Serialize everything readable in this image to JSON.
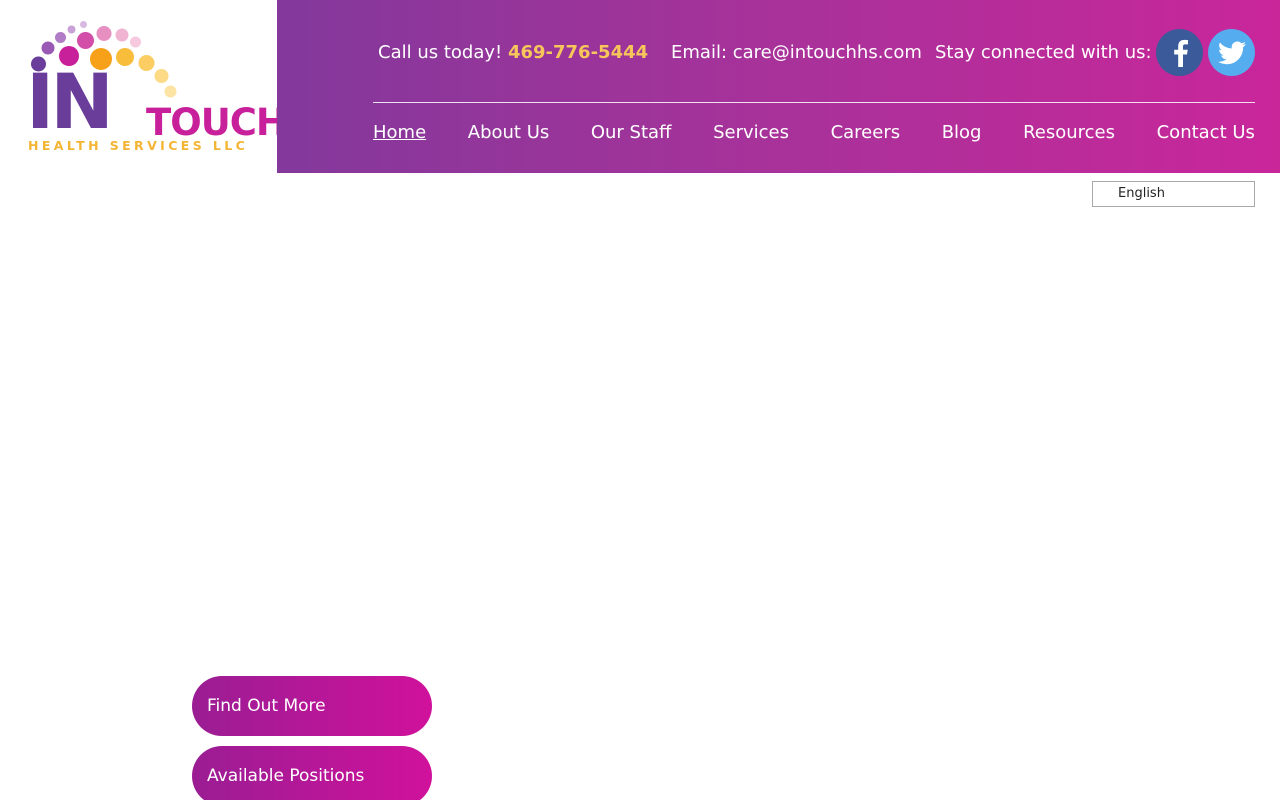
{
  "logo": {
    "word_in": "IN",
    "word_touch": "TOUCH",
    "tagline": "HEALTH SERVICES LLC",
    "colors": {
      "purple": "#6a3d9a",
      "magenta": "#c8209a",
      "orange": "#f4b534"
    }
  },
  "header": {
    "call_label": "Call us today!",
    "phone": "469-776-5444",
    "email_text": "Email: care@intouchhs.com",
    "stay_connected": "Stay connected with us:",
    "social": [
      {
        "name": "facebook",
        "icon": "facebook-icon",
        "color": "#3b5a9a"
      },
      {
        "name": "twitter",
        "icon": "twitter-icon",
        "color": "#55acee"
      }
    ],
    "gradient": [
      "#83389b",
      "#c9269a"
    ],
    "phone_color": "#f7c65a"
  },
  "nav": {
    "items": [
      {
        "label": "Home",
        "active": true
      },
      {
        "label": "About Us"
      },
      {
        "label": "Our Staff"
      },
      {
        "label": "Services"
      },
      {
        "label": "Careers"
      },
      {
        "label": "Blog"
      },
      {
        "label": "Resources"
      },
      {
        "label": "Contact Us"
      }
    ]
  },
  "language": {
    "selected": "English"
  },
  "buttons": {
    "find_out_more": "Find Out More",
    "available_positions": "Available Positions"
  }
}
